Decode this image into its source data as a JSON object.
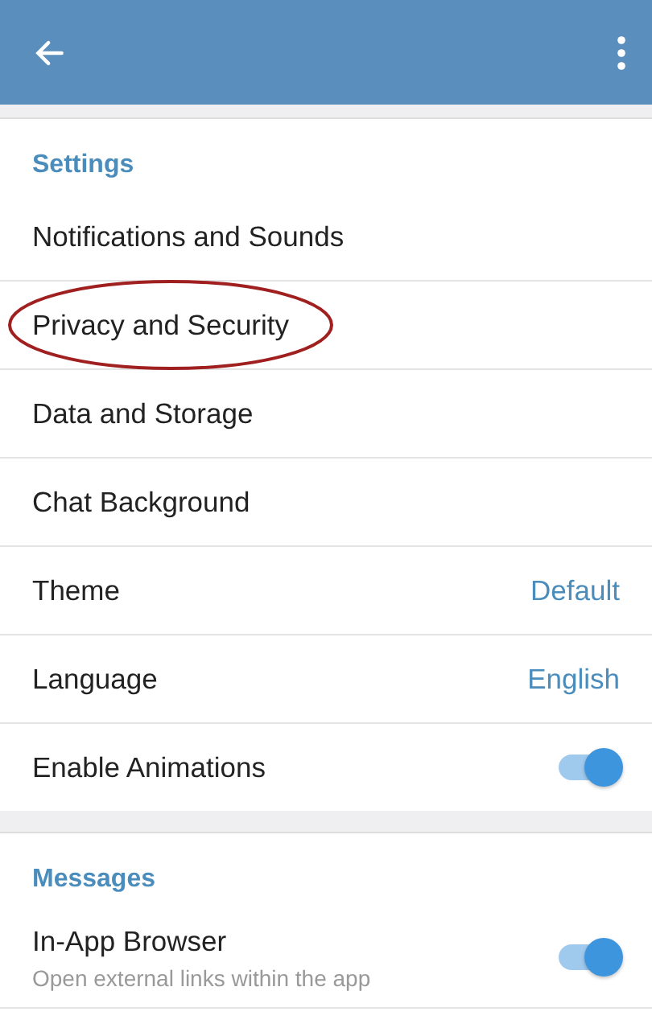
{
  "sections": [
    {
      "title": "Settings",
      "items": [
        {
          "kind": "link",
          "label": "Notifications and Sounds",
          "circled": false
        },
        {
          "kind": "link",
          "label": "Privacy and Security",
          "circled": true
        },
        {
          "kind": "link",
          "label": "Data and Storage",
          "circled": false
        },
        {
          "kind": "link",
          "label": "Chat Background",
          "circled": false
        },
        {
          "kind": "value",
          "label": "Theme",
          "value": "Default",
          "circled": false
        },
        {
          "kind": "value",
          "label": "Language",
          "value": "English",
          "circled": false
        },
        {
          "kind": "toggle",
          "label": "Enable Animations",
          "on": true,
          "circled": false
        }
      ]
    },
    {
      "title": "Messages",
      "items": [
        {
          "kind": "toggle",
          "label": "In-App Browser",
          "description": "Open external links within the app",
          "on": true,
          "circled": false
        }
      ]
    }
  ]
}
